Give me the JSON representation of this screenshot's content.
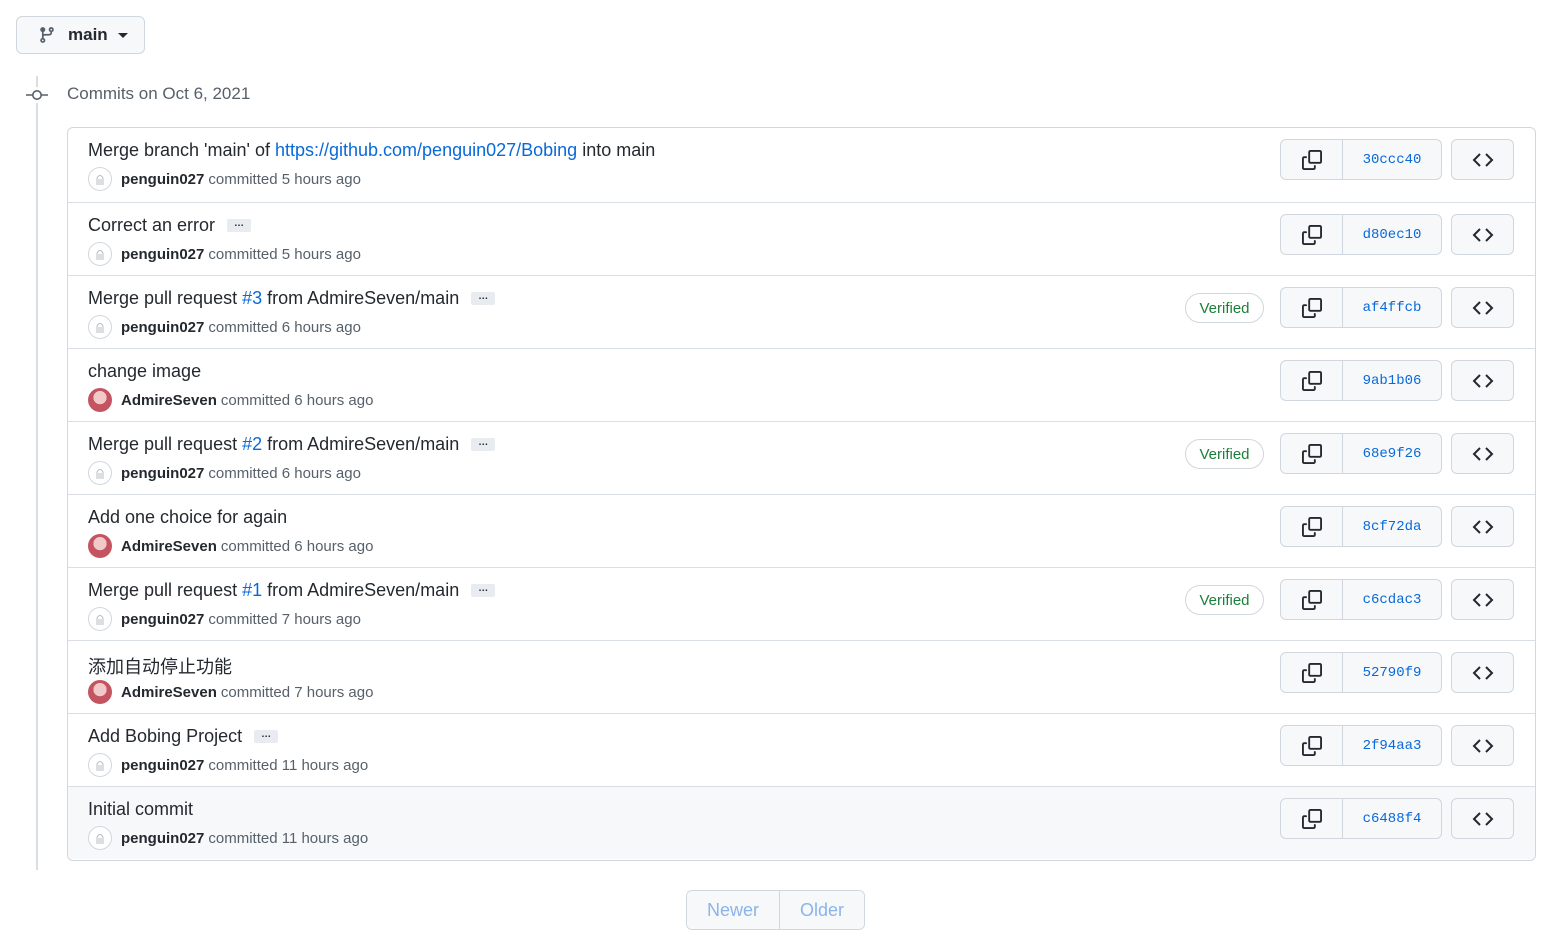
{
  "branch": {
    "name": "main",
    "icon": "git-branch-icon"
  },
  "group_title": "Commits on Oct 6, 2021",
  "commits": [
    {
      "message_parts": [
        "Merge branch 'main' of ",
        "https://github.com/penguin027/Bobing",
        " into main"
      ],
      "has_ellipsis": false,
      "author": "penguin027",
      "avatar": "peng",
      "action": "committed",
      "time": "5 hours ago",
      "verified": false,
      "sha": "30ccc40"
    },
    {
      "message_parts": [
        "Correct an error"
      ],
      "has_ellipsis": true,
      "author": "penguin027",
      "avatar": "peng",
      "action": "committed",
      "time": "5 hours ago",
      "verified": false,
      "sha": "d80ec10"
    },
    {
      "message_parts": [
        "Merge pull request ",
        "#3",
        " from AdmireSeven/main"
      ],
      "has_ellipsis": true,
      "author": "penguin027",
      "avatar": "peng",
      "action": "committed",
      "time": "6 hours ago",
      "verified": true,
      "sha": "af4ffcb"
    },
    {
      "message_parts": [
        "change image"
      ],
      "has_ellipsis": false,
      "author": "AdmireSeven",
      "avatar": "admire",
      "action": "committed",
      "time": "6 hours ago",
      "verified": false,
      "sha": "9ab1b06"
    },
    {
      "message_parts": [
        "Merge pull request ",
        "#2",
        " from AdmireSeven/main"
      ],
      "has_ellipsis": true,
      "author": "penguin027",
      "avatar": "peng",
      "action": "committed",
      "time": "6 hours ago",
      "verified": true,
      "sha": "68e9f26"
    },
    {
      "message_parts": [
        "Add one choice for again"
      ],
      "has_ellipsis": false,
      "author": "AdmireSeven",
      "avatar": "admire",
      "action": "committed",
      "time": "6 hours ago",
      "verified": false,
      "sha": "8cf72da"
    },
    {
      "message_parts": [
        "Merge pull request ",
        "#1",
        " from AdmireSeven/main"
      ],
      "has_ellipsis": true,
      "author": "penguin027",
      "avatar": "peng",
      "action": "committed",
      "time": "7 hours ago",
      "verified": true,
      "sha": "c6cdac3"
    },
    {
      "message_parts": [
        "添加自动停止功能"
      ],
      "has_ellipsis": false,
      "author": "AdmireSeven",
      "avatar": "admire",
      "action": "committed",
      "time": "7 hours ago",
      "verified": false,
      "sha": "52790f9"
    },
    {
      "message_parts": [
        "Add Bobing Project"
      ],
      "has_ellipsis": true,
      "author": "penguin027",
      "avatar": "peng",
      "action": "committed",
      "time": "11 hours ago",
      "verified": false,
      "sha": "2f94aa3"
    },
    {
      "message_parts": [
        "Initial commit"
      ],
      "has_ellipsis": false,
      "author": "penguin027",
      "avatar": "peng",
      "action": "committed",
      "time": "11 hours ago",
      "verified": false,
      "sha": "c6488f4"
    }
  ],
  "labels": {
    "verified": "Verified",
    "ellipsis": "…"
  },
  "icons": {
    "copy": "copy-icon",
    "browse": "code-brackets-icon",
    "commit": "git-commit-icon"
  },
  "pagination": {
    "newer": "Newer",
    "older": "Older"
  }
}
